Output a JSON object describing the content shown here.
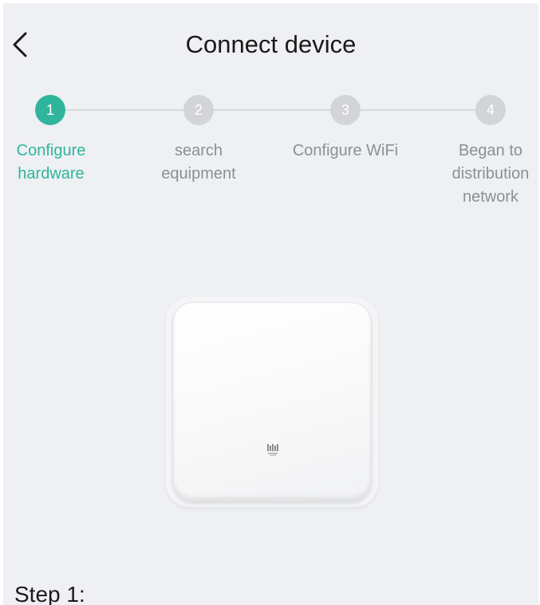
{
  "header": {
    "title": "Connect device",
    "back_icon": "chevron-left-icon"
  },
  "stepper": {
    "active_color": "#2fb59c",
    "inactive_color": "#d2d4d8",
    "steps": [
      {
        "number": "1",
        "label_line1": "Configure",
        "label_line2": "hardware",
        "label_line3": "",
        "active": true
      },
      {
        "number": "2",
        "label_line1": "search",
        "label_line2": "equipment",
        "label_line3": "",
        "active": false
      },
      {
        "number": "3",
        "label_line1": "Configure WiFi",
        "label_line2": "",
        "label_line3": "",
        "active": false
      },
      {
        "number": "4",
        "label_line1": "Began to",
        "label_line2": "distribution",
        "label_line3": "network",
        "active": false
      }
    ]
  },
  "device": {
    "image": "smart-hub-device-image",
    "logo_icon": "brand-logo-icon"
  },
  "instructions": {
    "step_heading": "Step 1:"
  }
}
